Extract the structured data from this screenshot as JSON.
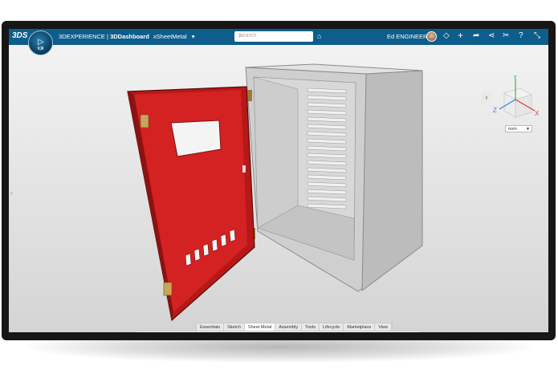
{
  "app": {
    "brand_logo": "3DS",
    "compass_version": "V,R",
    "title_brand": "3DEXPERIENCE",
    "title_separator": " | ",
    "title_app": "3DDashboard",
    "title_document": "xSheetMetal"
  },
  "search": {
    "placeholder": "Search"
  },
  "user": {
    "name": "Ed ENGINEER"
  },
  "icons": {
    "tag": "tag-icon",
    "add": "plus-icon",
    "share": "share-icon",
    "network": "network-icon",
    "tools": "tools-icon",
    "help": "help-icon",
    "collapse": "collapse-icon"
  },
  "nav_cube": {
    "x_label": "X",
    "y_label": "Y",
    "z_label": "Z",
    "view_select": "nom"
  },
  "tabs": [
    {
      "label": "Essentials"
    },
    {
      "label": "Sketch"
    },
    {
      "label": "Sheet Metal"
    },
    {
      "label": "Assembly"
    },
    {
      "label": "Tools"
    },
    {
      "label": "Lifecycle"
    },
    {
      "label": "Marketplace"
    },
    {
      "label": "View"
    }
  ],
  "active_tab": "Sheet Metal",
  "colors": {
    "topbar": "#0d5e8c",
    "door": "#d42121",
    "enclosure": "#c9c9c9",
    "axis_x": "#e03a3a",
    "axis_y": "#3bb34a",
    "axis_z": "#3a7fe0"
  }
}
